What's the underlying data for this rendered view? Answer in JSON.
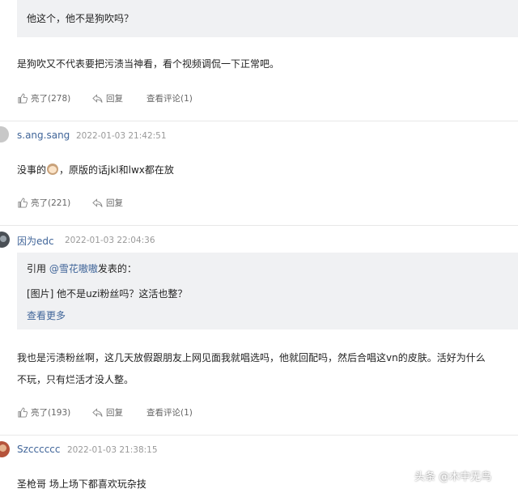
{
  "colors": {
    "link": "#406599",
    "quote_bg": "#f0f1f3",
    "divider": "#e8e8e8"
  },
  "comment0": {
    "quote_text": "他这个，他不是狗吹吗？",
    "body": "是狗吹又不代表要把污渍当神看，看个视频调侃一下正常吧。",
    "like": "亮了(278)",
    "reply": "回复",
    "view_replies": "查看评论(1)"
  },
  "comment1": {
    "user": "s.ang.sang",
    "time": "2022-01-03 21:42:51",
    "body_before": "没事的",
    "body_after": "，原版的话jkl和lwx都在放",
    "emoji_icon": "face-emoji-icon",
    "like": "亮了(221)",
    "reply": "回复"
  },
  "comment2": {
    "user": "因为edc",
    "time": "2022-01-03 22:04:36",
    "quote_prefix": "引用 ",
    "quote_user": "@雪花嗷嗷",
    "quote_suffix": "发表的：",
    "quote_text": "[图片] 他不是uzi粉丝吗？这活也整？",
    "see_more": "查看更多",
    "body_line1": "我也是污渍粉丝啊，这几天放假跟朋友上网见面我就唱选吗，他就回配吗，然后合唱这vn的皮肤。活好为什么",
    "body_line2": "不玩，只有烂活才没人整。",
    "like": "亮了(193)",
    "reply": "回复",
    "view_replies": "查看评论(1)"
  },
  "comment3": {
    "user": "Szcccccc",
    "time": "2022-01-03 21:38:15",
    "body": "圣枪哥 场上场下都喜欢玩杂技"
  },
  "watermark": "头条 @木中无鸟"
}
